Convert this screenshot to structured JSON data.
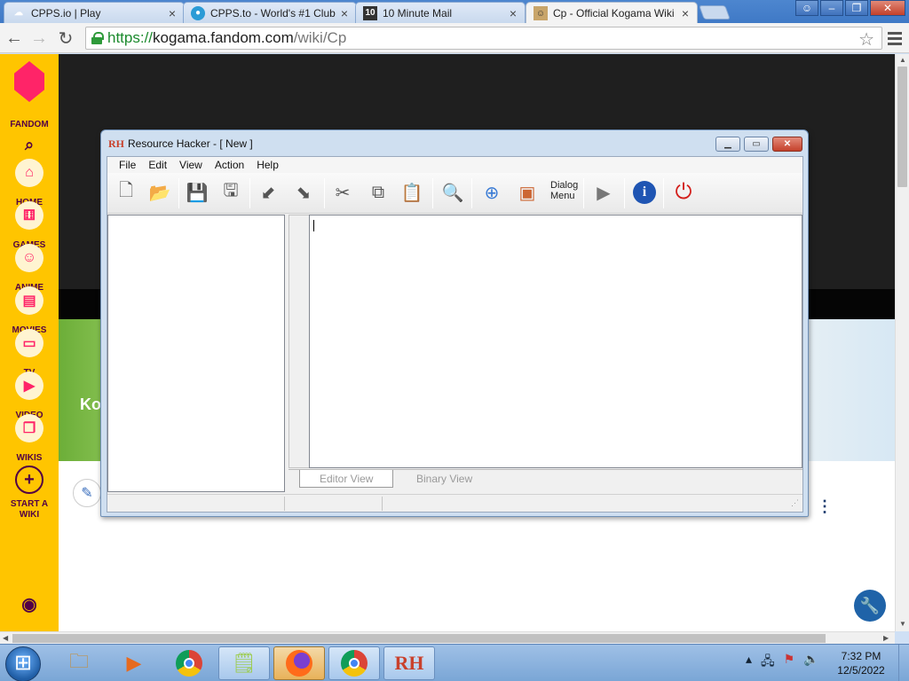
{
  "browser": {
    "tabs": [
      {
        "title": "CPPS.io | Play",
        "favicon": "cpps-logo-icon"
      },
      {
        "title": "CPPS.to - World's #1 Club",
        "favicon": "cpps-to-icon"
      },
      {
        "title": "10 Minute Mail",
        "favicon": "ten-minute-mail-icon",
        "favicon_text": "10"
      },
      {
        "title": "Cp - Official Kogama Wiki",
        "favicon": "kogama-wiki-icon",
        "active": true
      }
    ],
    "close_glyph": "×",
    "url": {
      "scheme": "https://",
      "host": "kogama.fandom.com",
      "path": "/wiki/Cp"
    }
  },
  "fandom_rail": {
    "brand": "FANDOM",
    "items": [
      {
        "label": "HOME",
        "icon": "home-icon"
      },
      {
        "label": "GAMES",
        "icon": "gamepad-icon"
      },
      {
        "label": "ANIME",
        "icon": "anime-icon"
      },
      {
        "label": "MOVIES",
        "icon": "clapperboard-icon"
      },
      {
        "label": "TV",
        "icon": "tv-icon"
      },
      {
        "label": "VIDEO",
        "icon": "video-icon"
      },
      {
        "label": "WIKIS",
        "icon": "book-icon"
      },
      {
        "label": "START A WIKI",
        "icon": "plus-circle-icon"
      }
    ]
  },
  "page": {
    "hero_title": "Ko"
  },
  "resource_hacker": {
    "title": "Resource Hacker - [ New ]",
    "icon_text": "RH",
    "menus": [
      "File",
      "Edit",
      "View",
      "Action",
      "Help"
    ],
    "toolbar_dialog_label_1": "Dialog",
    "toolbar_dialog_label_2": "Menu",
    "tabs": [
      "Editor View",
      "Binary View"
    ]
  },
  "taskbar": {
    "clock_time": "7:32 PM",
    "clock_date": "12/5/2022",
    "rh_label": "RH"
  },
  "colors": {
    "fandom_yellow": "#ffc500",
    "fandom_pink": "#ff2468",
    "url_green": "#1b8a2d"
  }
}
